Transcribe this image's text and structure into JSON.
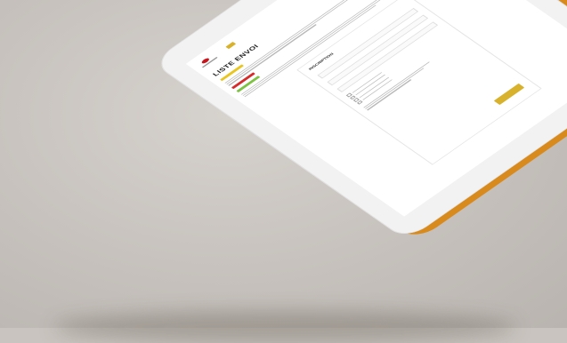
{
  "app": {
    "page_title": "LISTE ENVOI",
    "form_title": "INSCRIPTION",
    "submit_label": ""
  },
  "colors": {
    "background": "#c9c4bf",
    "tablet_edge": "#d98a1c",
    "accent": "#d8b22d",
    "badge_yellow": "#e8c61f",
    "badge_red": "#d52b2b",
    "badge_green": "#7dc243",
    "logo_red": "#c8151b"
  },
  "icons": [
    "search-icon",
    "user-icon",
    "cart-icon"
  ]
}
